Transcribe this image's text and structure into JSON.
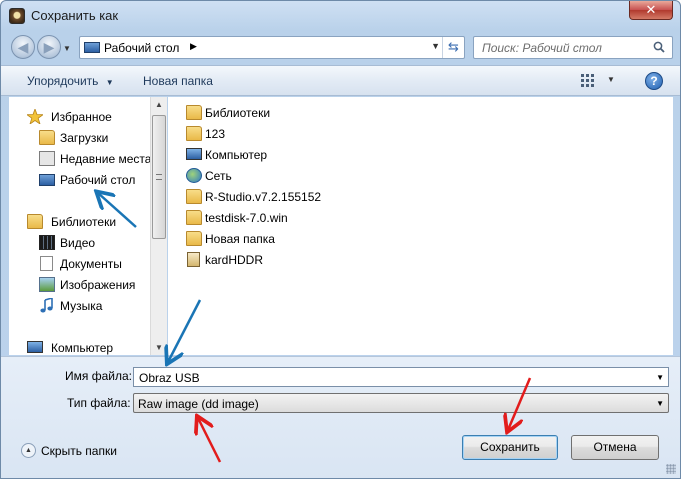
{
  "window": {
    "title": "Сохранить как",
    "close_label": "✕"
  },
  "nav": {
    "address": "Рабочий стол",
    "address_sep": "▶",
    "search_placeholder": "Поиск: Рабочий стол"
  },
  "toolbar": {
    "organize": "Упорядочить",
    "organize_arrow": "▼",
    "new_folder": "Новая папка",
    "help": "?"
  },
  "sidebar": {
    "items": [
      {
        "label": "Избранное",
        "icon": "star-icon"
      },
      {
        "label": "Загрузки",
        "icon": "downloads-folder-icon"
      },
      {
        "label": "Недавние места",
        "icon": "recent-places-icon"
      },
      {
        "label": "Рабочий стол",
        "icon": "desktop-icon"
      },
      {
        "label": "Библиотеки",
        "icon": "libraries-icon"
      },
      {
        "label": "Видео",
        "icon": "video-icon"
      },
      {
        "label": "Документы",
        "icon": "documents-icon"
      },
      {
        "label": "Изображения",
        "icon": "pictures-icon"
      },
      {
        "label": "Музыка",
        "icon": "music-icon"
      },
      {
        "label": "Компьютер",
        "icon": "computer-icon"
      }
    ]
  },
  "files": {
    "items": [
      {
        "name": "Библиотеки",
        "icon": "libraries-icon"
      },
      {
        "name": "123",
        "icon": "user-folder-icon"
      },
      {
        "name": "Компьютер",
        "icon": "computer-icon"
      },
      {
        "name": "Сеть",
        "icon": "network-icon"
      },
      {
        "name": "R-Studio.v7.2.155152",
        "icon": "folder-icon"
      },
      {
        "name": "testdisk-7.0.win",
        "icon": "folder-icon"
      },
      {
        "name": "Новая папка",
        "icon": "folder-icon"
      },
      {
        "name": "kardHDDR",
        "icon": "file-icon"
      }
    ]
  },
  "form": {
    "filename_label": "Имя файла:",
    "filename_value": "Obraz USB",
    "filetype_label": "Тип файла:",
    "filetype_value": "Raw image (dd image)"
  },
  "footer": {
    "hide_folders": "Скрыть папки",
    "save": "Сохранить",
    "cancel": "Отмена"
  },
  "colors": {
    "annotation_blue": "#1a75b5",
    "annotation_red": "#e21c1c"
  }
}
